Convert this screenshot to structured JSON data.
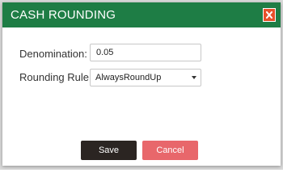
{
  "dialog": {
    "title": "CASH ROUNDING",
    "close_icon": "close-icon",
    "colors": {
      "titlebar": "#1e7d45",
      "close_button": "#e8502b",
      "save_button": "#2b2522",
      "cancel_button": "#e8676b"
    }
  },
  "form": {
    "denomination_label": "Denomination:",
    "denomination_value": "0.05",
    "rounding_rule_label": "Rounding Rule:",
    "rounding_rule_value": "AlwaysRoundUp"
  },
  "buttons": {
    "save": "Save",
    "cancel": "Cancel"
  }
}
